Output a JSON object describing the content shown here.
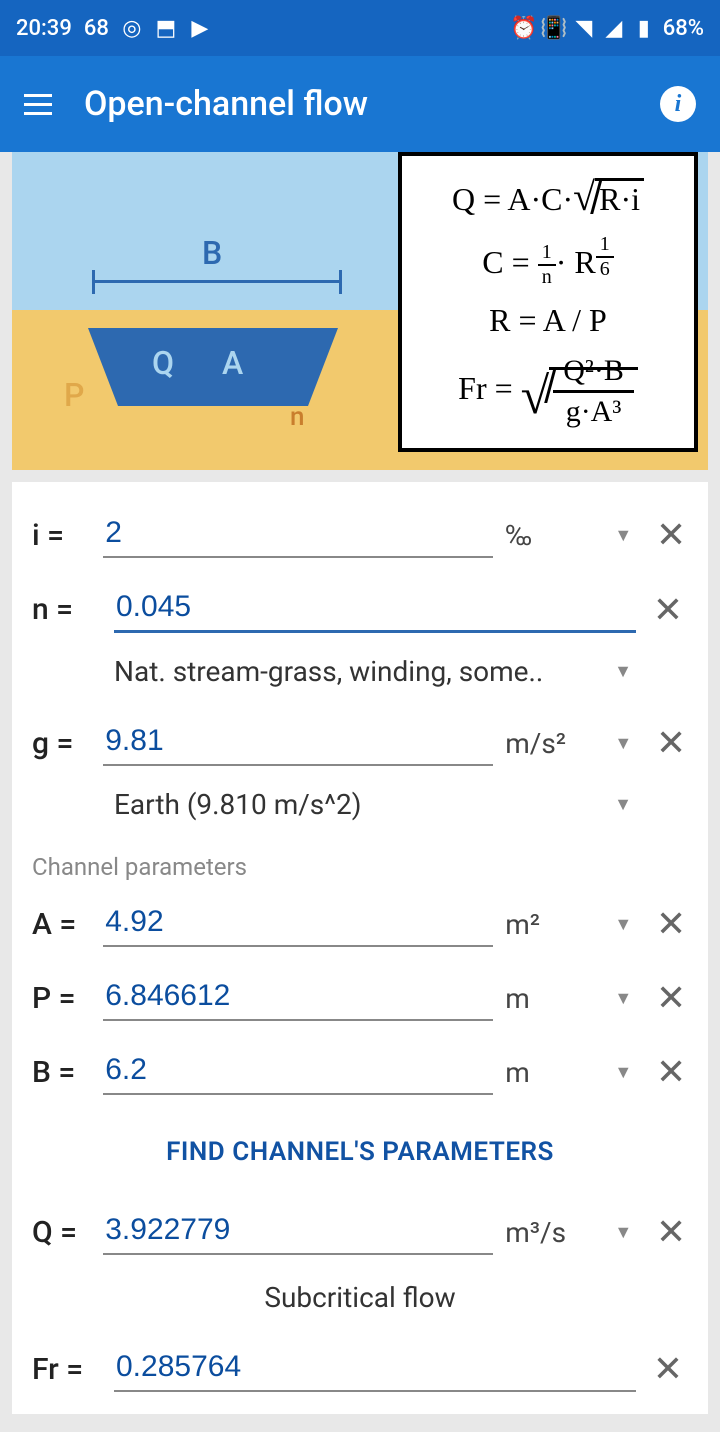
{
  "status": {
    "time": "20:39",
    "temp": "68",
    "battery": "68%"
  },
  "header": {
    "title": "Open-channel flow"
  },
  "diagram": {
    "b": "B",
    "q": "Q",
    "a": "A",
    "p": "P",
    "n": "n"
  },
  "formulas": {
    "q": "Q = A·C·",
    "q_sqrt": "R·i",
    "c": "C = ",
    "c_rhs": "· R",
    "r": "R = A / P",
    "fr": "Fr = "
  },
  "rows": {
    "i": {
      "label": "i =",
      "value": "2",
      "unit": "‰"
    },
    "n": {
      "label": "n =",
      "value": "0.045",
      "preset": "Nat. stream-grass, winding, some.."
    },
    "g": {
      "label": "g =",
      "value": "9.81",
      "unit": "m/s²",
      "preset": "Earth (9.810 m/s^2)"
    },
    "A": {
      "label": "A =",
      "value": "4.92",
      "unit": "m²"
    },
    "P": {
      "label": "P =",
      "value": "6.846612",
      "unit": "m"
    },
    "B": {
      "label": "B =",
      "value": "6.2",
      "unit": "m"
    },
    "Q": {
      "label": "Q =",
      "value": "3.922779",
      "unit": "m³/s"
    },
    "Fr": {
      "label": "Fr =",
      "value": "0.285764"
    }
  },
  "section": "Channel parameters",
  "action": "FIND CHANNEL'S PARAMETERS",
  "flow_status": "Subcritical flow"
}
